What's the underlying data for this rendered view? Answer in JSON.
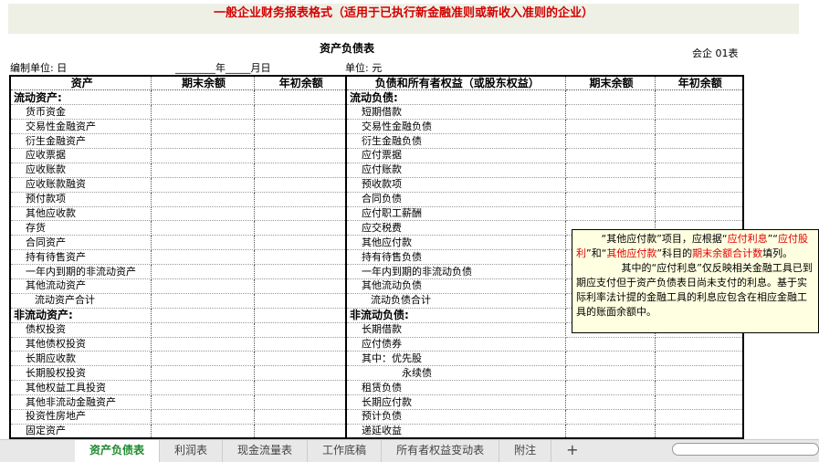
{
  "banner": "一般企业财务报表格式（适用于已执行新金融准则或新收入准则的企业）",
  "title": "资产负债表",
  "form_code": "会企 01表",
  "unit_label": "编制单位: 日",
  "date_label": "________年_____月日",
  "currency_label": "单位: 元",
  "headers": [
    "资产",
    "期末余额",
    "年初余额",
    "负债和所有者权益（或股东权益）",
    "期末余额",
    "年初余额"
  ],
  "left": [
    "流动资产:",
    "货币资金",
    "交易性金融资产",
    "衍生金融资产",
    "应收票据",
    "应收账款",
    "应收账款融资",
    "预付款项",
    "其他应收款",
    "存货",
    "合同资产",
    "持有待售资产",
    "一年内到期的非流动资产",
    "其他流动资产",
    "流动资产合计",
    "非流动资产:",
    "债权投资",
    "其他债权投资",
    "长期应收款",
    "长期股权投资",
    "其他权益工具投资",
    "其他非流动金融资产",
    "投资性房地产",
    "固定资产"
  ],
  "right": [
    "流动负债:",
    "短期借款",
    "交易性金融负债",
    "衍生金融负债",
    "应付票据",
    "应付账款",
    "预收款项",
    "合同负债",
    "应付职工薪酬",
    "应交税费",
    "其他应付款",
    "持有待售负债",
    "一年内到期的非流动负债",
    "其他流动负债",
    "流动负债合计",
    "非流动负债:",
    "长期借款",
    "应付债券",
    "其中：优先股",
    "永续债",
    "租赁负债",
    "长期应付款",
    "预计负债",
    "递延收益"
  ],
  "tooltip": {
    "p1a": "“其他应付款”项目，应根据“",
    "p1b": "应付利息",
    "p1c": "”“",
    "p1d": "应付股利",
    "p1e": "”和“",
    "p1f": "其他应付款",
    "p1g": "”科目的",
    "p1h": "期末余额合计数",
    "p1i": "填列。",
    "p2": "其中的“应付利息”仅反映相关金融工具已到期应支付但于资产负债表日尚未支付的利息。基于实际利率法计提的金融工具的利息应包含在相应金融工具的账面余额中。"
  },
  "tabs": [
    "资产负债表",
    "利润表",
    "现金流量表",
    "工作底稿",
    "所有者权益变动表",
    "附注"
  ],
  "add_tab": "+"
}
